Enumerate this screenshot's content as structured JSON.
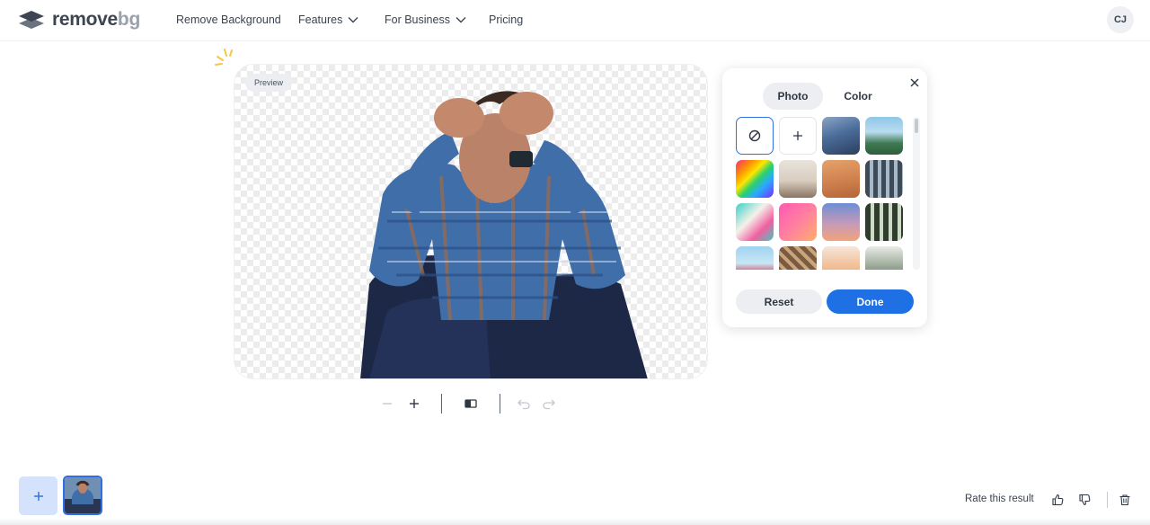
{
  "header": {
    "logo_main": "remove",
    "logo_suffix": "bg",
    "nav": [
      {
        "label": "Remove Background"
      },
      {
        "label": "Features"
      },
      {
        "label": "For Business"
      },
      {
        "label": "Pricing"
      }
    ],
    "avatar_initials": "CJ"
  },
  "preview": {
    "badge": "Preview"
  },
  "panel": {
    "tabs": [
      {
        "label": "Photo",
        "active": true
      },
      {
        "label": "Color",
        "active": false
      }
    ],
    "reset_label": "Reset",
    "done_label": "Done"
  },
  "footer": {
    "rate_label": "Rate this result"
  },
  "colors": {
    "accent": "#1f6fe5",
    "add_tile": "#d4e2fc"
  }
}
